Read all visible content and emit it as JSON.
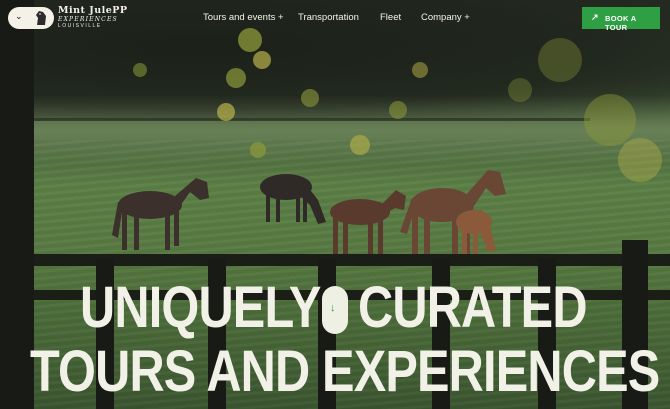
{
  "brand": {
    "name_line1": "Mint JulePP",
    "name_line2": "EXPERIENCES",
    "name_line3": "LOUISVILLE"
  },
  "nav": {
    "items": [
      {
        "label": "Tours and events +"
      },
      {
        "label": "Transportation"
      },
      {
        "label": "Fleet"
      },
      {
        "label": "Company +"
      }
    ],
    "cta": "BOOK A TOUR"
  },
  "hero": {
    "line1_word1": "UNIQUELY",
    "line1_word2": "CURATED",
    "line2": "TOURS AND EXPERIENCES"
  },
  "icons": {
    "logo_toggle": "chevron-down-icon",
    "logo_mark": "horse-head-icon",
    "cta_icon": "arrow-icon",
    "scroll": "arrow-down-icon"
  },
  "colors": {
    "accent": "#2ea043",
    "text": "#f2f1e8"
  }
}
